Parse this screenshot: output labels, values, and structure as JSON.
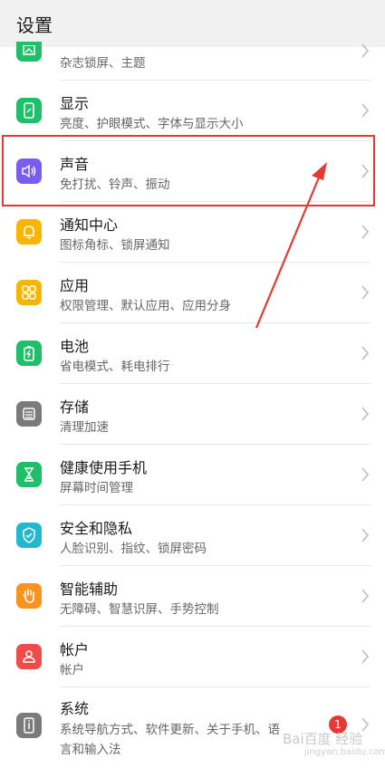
{
  "header": {
    "title": "设置"
  },
  "items": [
    {
      "label": "",
      "sub": "杂志锁屏、主题",
      "icon": "wallpaper-icon",
      "color": "#1fbf6a"
    },
    {
      "label": "显示",
      "sub": "亮度、护眼模式、字体与显示大小",
      "icon": "display-icon",
      "color": "#1fbf6a"
    },
    {
      "label": "声音",
      "sub": "免打扰、铃声、振动",
      "icon": "sound-icon",
      "color": "#7b5cf0"
    },
    {
      "label": "通知中心",
      "sub": "图标角标、锁屏通知",
      "icon": "bell-icon",
      "color": "#f7b500"
    },
    {
      "label": "应用",
      "sub": "权限管理、默认应用、应用分身",
      "icon": "apps-icon",
      "color": "#f7b500"
    },
    {
      "label": "电池",
      "sub": "省电模式、耗电排行",
      "icon": "battery-icon",
      "color": "#1fbf6a"
    },
    {
      "label": "存储",
      "sub": "清理加速",
      "icon": "storage-icon",
      "color": "#7a7a7a"
    },
    {
      "label": "健康使用手机",
      "sub": "屏幕时间管理",
      "icon": "hourglass-icon",
      "color": "#1fbf6a"
    },
    {
      "label": "安全和隐私",
      "sub": "人脸识别、指纹、锁屏密码",
      "icon": "shield-icon",
      "color": "#22b8cf"
    },
    {
      "label": "智能辅助",
      "sub": "无障碍、智慧识屏、手势控制",
      "icon": "hand-icon",
      "color": "#f7931e"
    },
    {
      "label": "帐户",
      "sub": "帐户",
      "icon": "account-icon",
      "color": "#ef4b4b"
    },
    {
      "label": "系统",
      "sub": "系统导航方式、软件更新、关于手机、语",
      "sub2": "言和输入法",
      "icon": "system-icon",
      "color": "#7a7a7a"
    }
  ],
  "badge": "1",
  "watermark": "Bai百度 经验",
  "watermark_url": "jingyan.baidu.com"
}
